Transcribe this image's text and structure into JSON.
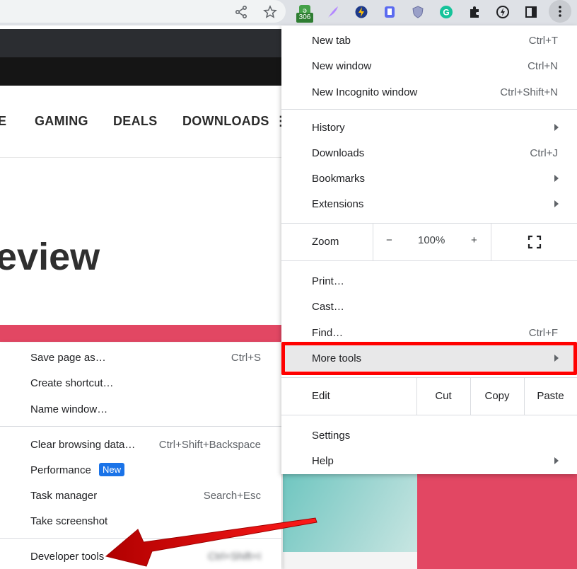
{
  "toolbar": {
    "share_icon": "share-icon",
    "star_icon": "star-icon",
    "extension_badge": "306",
    "extensions": [
      "tracker-extension-icon",
      "quill-extension-icon",
      "lightning-extension-icon",
      "bookmark-extension-icon",
      "shield-extension-icon",
      "grammarly-extension-icon",
      "puzzle-icon",
      "clock-extension-icon",
      "side-panel-icon",
      "more-menu-icon"
    ]
  },
  "page": {
    "nav_items": [
      "E",
      "GAMING",
      "DEALS",
      "DOWNLOADS"
    ],
    "nav_more": "⋮",
    "heading": "eview"
  },
  "menu": {
    "new_tab": {
      "label": "New tab",
      "shortcut": "Ctrl+T"
    },
    "new_window": {
      "label": "New window",
      "shortcut": "Ctrl+N"
    },
    "new_incognito": {
      "label": "New Incognito window",
      "shortcut": "Ctrl+Shift+N"
    },
    "history": {
      "label": "History"
    },
    "downloads": {
      "label": "Downloads",
      "shortcut": "Ctrl+J"
    },
    "bookmarks": {
      "label": "Bookmarks"
    },
    "extensions": {
      "label": "Extensions"
    },
    "zoom": {
      "label": "Zoom",
      "minus": "−",
      "value": "100%",
      "plus": "+"
    },
    "print": {
      "label": "Print…"
    },
    "cast": {
      "label": "Cast…"
    },
    "find": {
      "label": "Find…",
      "shortcut": "Ctrl+F"
    },
    "more_tools": {
      "label": "More tools"
    },
    "edit": {
      "label": "Edit",
      "cut": "Cut",
      "copy": "Copy",
      "paste": "Paste"
    },
    "settings": {
      "label": "Settings"
    },
    "help": {
      "label": "Help"
    }
  },
  "submenu": {
    "save_page": {
      "label": "Save page as…",
      "shortcut": "Ctrl+S"
    },
    "create_shortcut": {
      "label": "Create shortcut…"
    },
    "name_window": {
      "label": "Name window…"
    },
    "clear_data": {
      "label": "Clear browsing data…",
      "shortcut": "Ctrl+Shift+Backspace"
    },
    "performance": {
      "label": "Performance",
      "badge": "New"
    },
    "task_manager": {
      "label": "Task manager",
      "shortcut": "Search+Esc"
    },
    "screenshot": {
      "label": "Take screenshot"
    },
    "developer_tools": {
      "label": "Developer tools",
      "shortcut": "Ctrl+Shift+I"
    }
  },
  "colors": {
    "highlight_box": "#ff0000",
    "accent_pink": "#e24763",
    "badge_blue": "#1a73e8"
  }
}
